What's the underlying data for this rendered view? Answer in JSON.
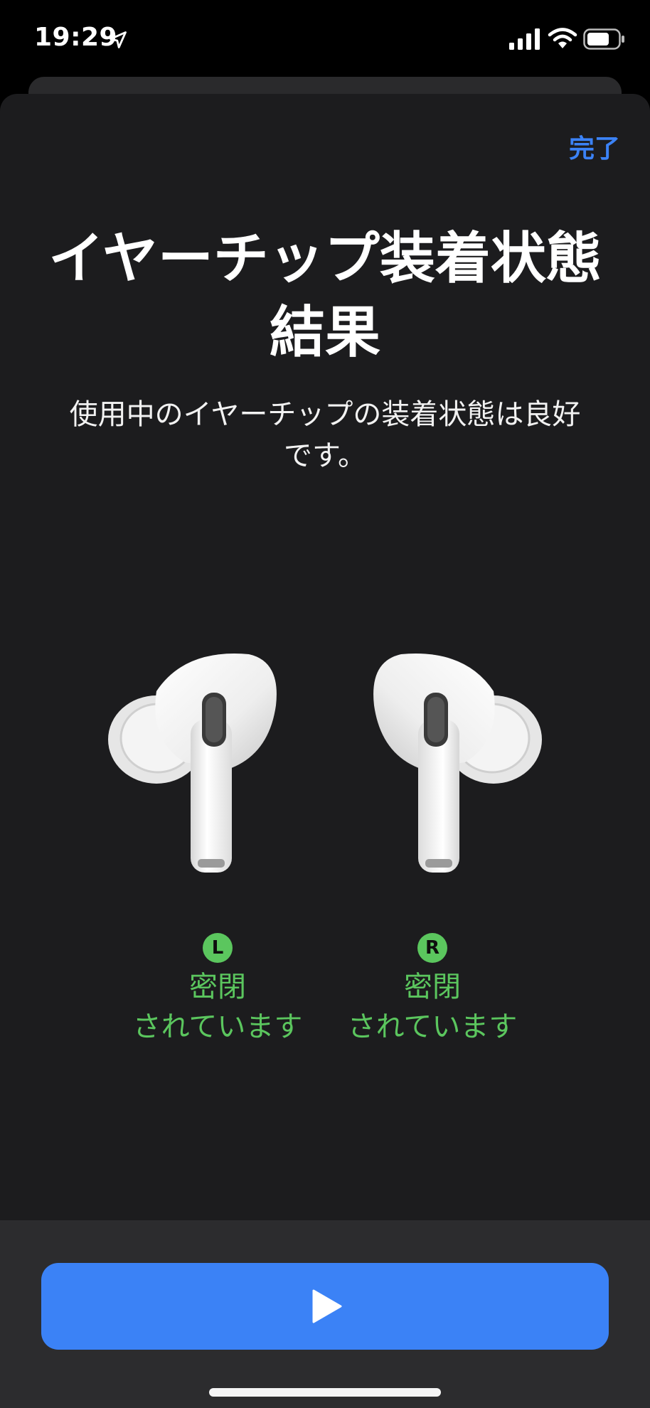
{
  "status_bar": {
    "time": "19:29",
    "icons": [
      "location-arrow-icon",
      "signal-bars-icon",
      "wifi-icon",
      "battery-icon"
    ]
  },
  "header": {
    "done_label": "完了"
  },
  "main": {
    "title": "イヤーチップ装着状態結果",
    "subtitle": "使用中のイヤーチップの装着状態は良好です。"
  },
  "earbuds": {
    "left": {
      "badge": "L",
      "status_line1": "密閉",
      "status_line2": "されています"
    },
    "right": {
      "badge": "R",
      "status_line1": "密閉",
      "status_line2": "されています"
    }
  },
  "footer": {
    "play_icon": "play-icon"
  },
  "colors": {
    "accent": "#3b82f6",
    "success": "#5bc65e",
    "sheet_background": "#1c1c1e",
    "bottom_bar": "#2c2c2e"
  }
}
